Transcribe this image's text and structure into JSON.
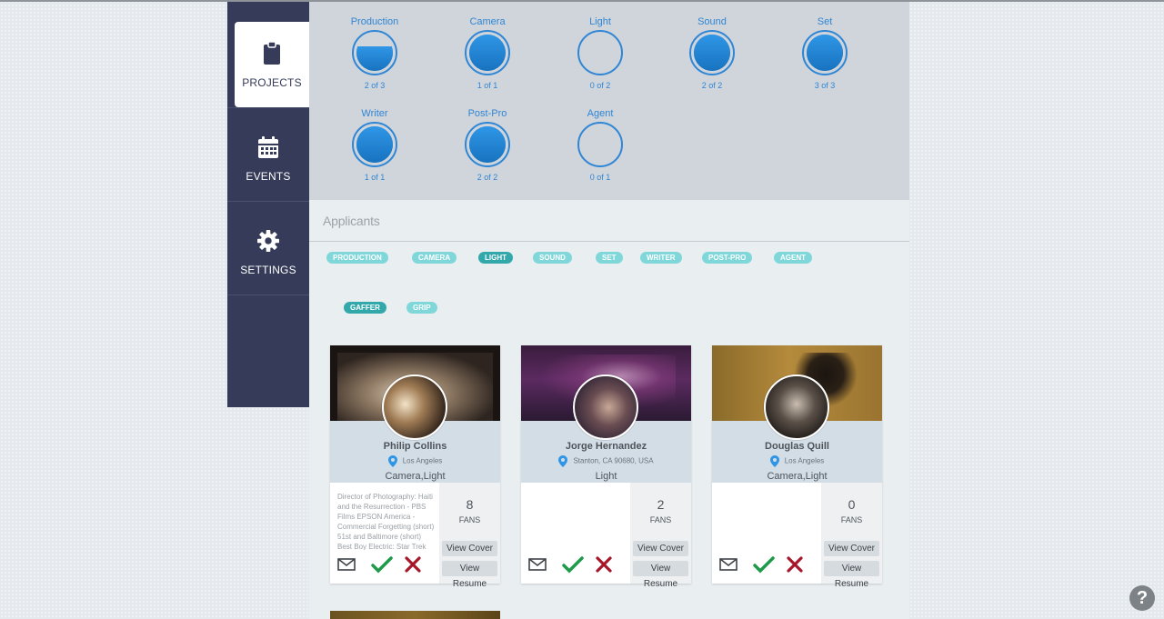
{
  "sidebar": {
    "items": [
      {
        "label": "PROJECTS",
        "icon": "clipboard-icon"
      },
      {
        "label": "EVENTS",
        "icon": "calendar-icon"
      },
      {
        "label": "SETTINGS",
        "icon": "gear-icon"
      }
    ],
    "active": "PROJECTS"
  },
  "crew": [
    {
      "name": "Production",
      "count": "2 of 3",
      "filled": 2,
      "total": 3
    },
    {
      "name": "Camera",
      "count": "1 of 1",
      "filled": 1,
      "total": 1
    },
    {
      "name": "Light",
      "count": "0 of 2",
      "filled": 0,
      "total": 2
    },
    {
      "name": "Sound",
      "count": "2 of 2",
      "filled": 2,
      "total": 2
    },
    {
      "name": "Set",
      "count": "3 of 3",
      "filled": 3,
      "total": 3
    },
    {
      "name": "Writer",
      "count": "1 of 1",
      "filled": 1,
      "total": 1
    },
    {
      "name": "Post-Pro",
      "count": "2 of 2",
      "filled": 2,
      "total": 2
    },
    {
      "name": "Agent",
      "count": "0 of 1",
      "filled": 0,
      "total": 1
    }
  ],
  "applicants": {
    "title": "Applicants",
    "categories": [
      "PRODUCTION",
      "CAMERA",
      "LIGHT",
      "SOUND",
      "SET",
      "WRITER",
      "POST-PRO",
      "AGENT"
    ],
    "active_category": "LIGHT",
    "subcategories": [
      "GAFFER",
      "GRIP"
    ],
    "active_subcategory": "GAFFER"
  },
  "cards": [
    {
      "name": "Philip Collins",
      "location": "Los Angeles",
      "roles": "Camera,Light",
      "bio": "Director of Photography: Haiti and the Resurrection - PBS Films EPSON America - Commercial Forgetting (short) 51st and Baltimore (short) Best Boy Electric: Star Trek Beyond",
      "fans": "8",
      "fans_label": "FANS",
      "view_cover": "View Cover",
      "view_resume": "View Resume"
    },
    {
      "name": "Jorge Hernandez",
      "location": "Stanton, CA 90680, USA",
      "roles": "Light",
      "bio": "",
      "fans": "2",
      "fans_label": "FANS",
      "view_cover": "View Cover",
      "view_resume": "View Resume"
    },
    {
      "name": "Douglas Quill",
      "location": "Los Angeles",
      "roles": "Camera,Light",
      "bio": "",
      "fans": "0",
      "fans_label": "FANS",
      "view_cover": "View Cover",
      "view_resume": "View Resume"
    }
  ],
  "help_label": "?",
  "colors": {
    "sidebar_bg": "#353b58",
    "accent_blue": "#2f86d4",
    "chip": "#7fd7d9",
    "chip_active": "#32a8ab",
    "accept": "#1f9a4a",
    "reject": "#a8162a"
  }
}
